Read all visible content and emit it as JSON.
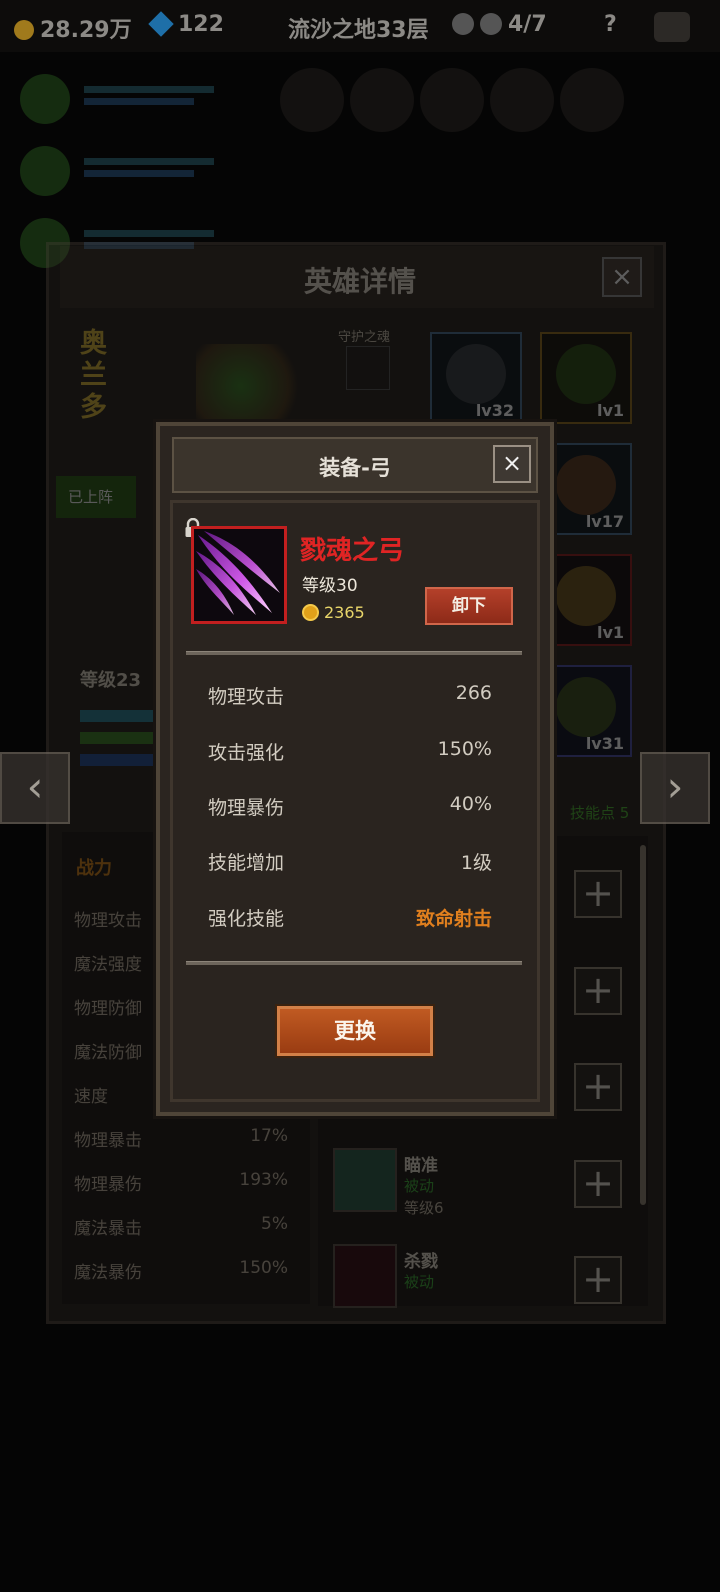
{
  "topbar": {
    "gold": "28.29万",
    "gems": "122",
    "location": "流沙之地33层",
    "keys": "4/7",
    "help": "?"
  },
  "hero_detail": {
    "title": "英雄详情",
    "close": "×",
    "hero_name": "奥兰多",
    "guardian_label": "守护之魂",
    "deployed": "已上阵",
    "level": "等级23",
    "skill_points": "技能点 5",
    "stats_title": "战力",
    "stats": [
      {
        "label": "物理攻击",
        "value": ""
      },
      {
        "label": "魔法强度",
        "value": ""
      },
      {
        "label": "物理防御",
        "value": ""
      },
      {
        "label": "魔法防御",
        "value": ""
      },
      {
        "label": "速度",
        "value": ""
      },
      {
        "label": "物理暴击",
        "value": "17%"
      },
      {
        "label": "物理暴伤",
        "value": "193%"
      },
      {
        "label": "魔法暴击",
        "value": "5%"
      },
      {
        "label": "魔法暴伤",
        "value": "150%"
      }
    ],
    "equipment": [
      {
        "icon": "helmet-icon",
        "level": "lv32"
      },
      {
        "icon": "wreath-icon",
        "level": "lv1"
      },
      {
        "icon": "belt-icon",
        "level": "lv17"
      },
      {
        "icon": "ring-icon",
        "level": "lv1"
      },
      {
        "icon": "shield-icon",
        "level": "lv31"
      }
    ],
    "skills": [
      {
        "name": "瞄准",
        "type": "被动",
        "level": "等级6"
      },
      {
        "name": "杀戮",
        "type": "被动",
        "level": ""
      }
    ],
    "prev": "‹",
    "next": "›",
    "plus": "+"
  },
  "equip_modal": {
    "title": "装备-弓",
    "close": "×",
    "item_name": "戮魂之弓",
    "item_level": "等级30",
    "price": "2365",
    "unequip_label": "卸下",
    "attributes": [
      {
        "label": "物理攻击",
        "value": "266"
      },
      {
        "label": "攻击强化",
        "value": "150%"
      },
      {
        "label": "物理暴伤",
        "value": "40%"
      },
      {
        "label": "技能增加",
        "value": "1级"
      },
      {
        "label": "强化技能",
        "value": "致命射击"
      }
    ],
    "replace_label": "更换"
  },
  "colors": {
    "item_name": "#e02424",
    "highlight_value": "#e07f1e",
    "button": "#b4402a",
    "passive": "#3fa33a"
  }
}
